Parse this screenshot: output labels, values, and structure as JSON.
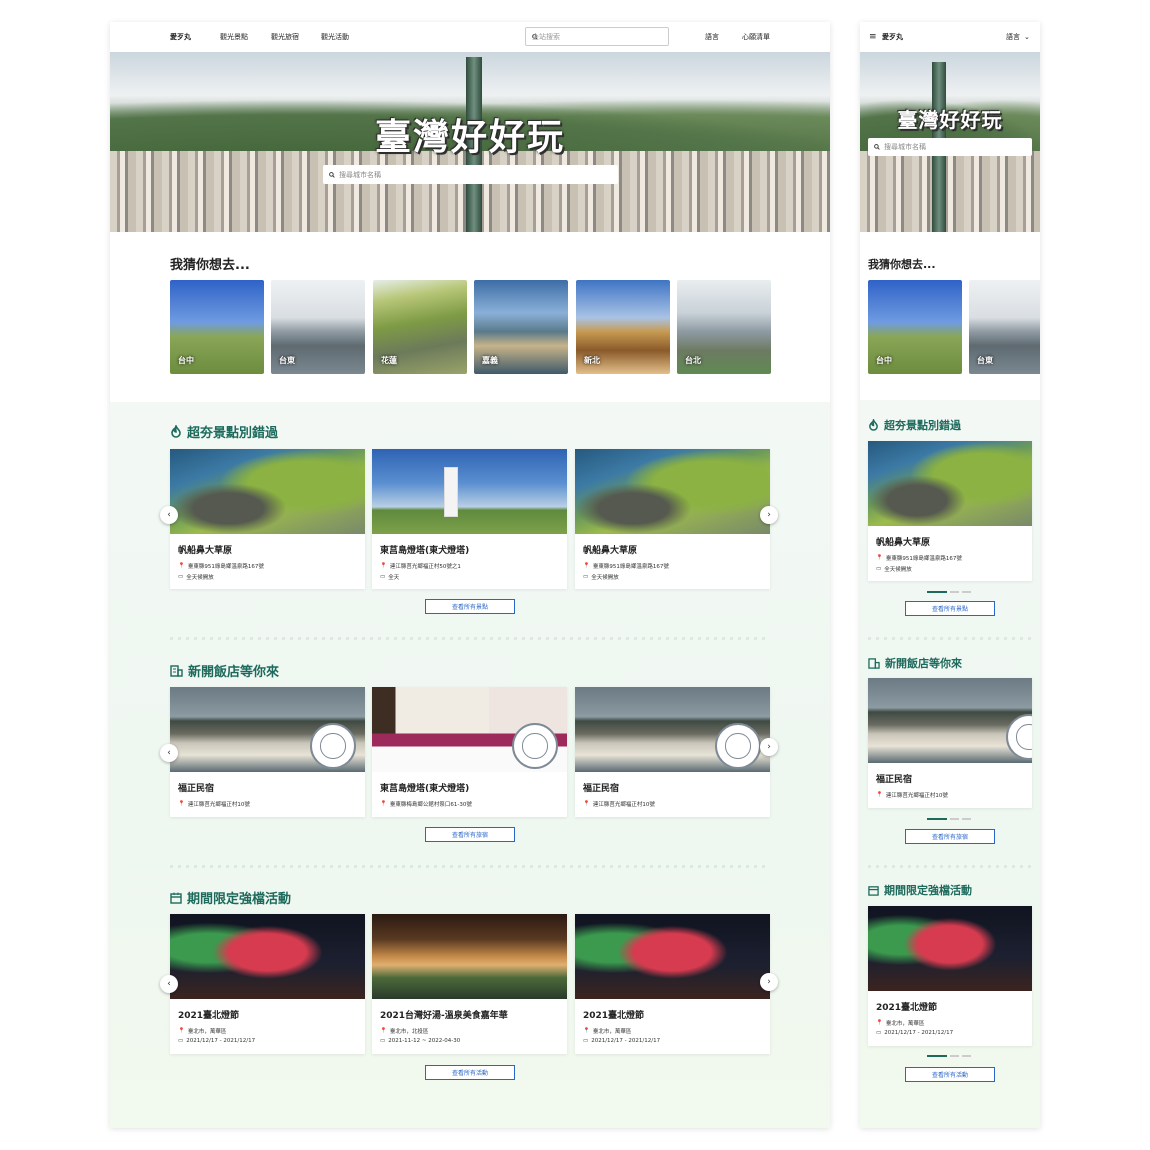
{
  "desktop": {
    "nav": {
      "logo": "愛歹丸",
      "links": [
        "觀光景點",
        "觀光旅宿",
        "觀光活動"
      ],
      "search_placeholder": "全站搜索",
      "language": "語言",
      "wishlist": "心願清單"
    },
    "hero": {
      "title": "臺灣好好玩",
      "search_placeholder": "搜尋城市名稱"
    },
    "guess": {
      "heading": "我猜你想去...",
      "cities": [
        "台中",
        "台東",
        "花蓮",
        "嘉義",
        "新北",
        "台北"
      ]
    },
    "spots": {
      "heading": "超夯景點別錯過",
      "cards": [
        {
          "title": "帆船鼻大草原",
          "address": "臺東縣951綠島鄉溫泉路167號",
          "hours": "全天候開放"
        },
        {
          "title": "東莒島燈塔(東犬燈塔)",
          "address": "連江縣莒光鄉福正村50號之1",
          "hours": "全天"
        },
        {
          "title": "帆船鼻大草原",
          "address": "臺東縣951綠島鄉溫泉路167號",
          "hours": "全天候開放"
        }
      ],
      "more": "查看所有景點"
    },
    "hotels": {
      "heading": "新開飯店等你來",
      "cards": [
        {
          "title": "福正民宿",
          "address": "連江縣莒光鄉福正村10號"
        },
        {
          "title": "東莒島燈塔(東犬燈塔)",
          "address": "臺東縣梅島鄉公館村祭口61-30號"
        },
        {
          "title": "福正民宿",
          "address": "連江縣莒光鄉福正村10號"
        }
      ],
      "more": "查看所有旅宿"
    },
    "events": {
      "heading": "期間限定強檔活動",
      "cards": [
        {
          "title": "2021臺北燈節",
          "place": "臺北市，萬華區",
          "date": "2021/12/17 - 2021/12/17"
        },
        {
          "title": "2021台灣好湯-溫泉美食嘉年華",
          "place": "臺北市，北投區",
          "date": "2021-11-12 ~ 2022-04-30"
        },
        {
          "title": "2021臺北燈節",
          "place": "臺北市，萬華區",
          "date": "2021/12/17 - 2021/12/17"
        }
      ],
      "more": "查看所有活動"
    }
  },
  "mobile": {
    "nav": {
      "logo": "愛歹丸",
      "language": "語言"
    },
    "hero": {
      "title": "臺灣好好玩",
      "search_placeholder": "搜尋城市名稱"
    },
    "guess": {
      "heading": "我猜你想去...",
      "cities": [
        "台中",
        "台東"
      ]
    },
    "spots": {
      "heading": "超夯景點別錯過",
      "card": {
        "title": "帆船鼻大草原",
        "address": "臺東縣951綠島鄉溫泉路167號",
        "hours": "全天候開放"
      },
      "more": "查看所有景點"
    },
    "hotels": {
      "heading": "新開飯店等你來",
      "card": {
        "title": "福正民宿",
        "address": "連江縣莒光鄉福正村10號"
      },
      "more": "查看所有旅宿"
    },
    "events": {
      "heading": "期間限定強檔活動",
      "card": {
        "title": "2021臺北燈節",
        "place": "臺北市，萬華區",
        "date": "2021/12/17 - 2021/12/17"
      },
      "more": "查看所有活動"
    }
  },
  "colors": {
    "accent": "#1d6a5c",
    "link": "#2a66c8"
  },
  "icons": [
    "search-icon",
    "fire-icon",
    "hotel-icon",
    "calendar-icon",
    "pin-icon",
    "clock-icon",
    "chevron-left-icon",
    "chevron-right-icon",
    "menu-icon",
    "chevron-down-icon"
  ]
}
